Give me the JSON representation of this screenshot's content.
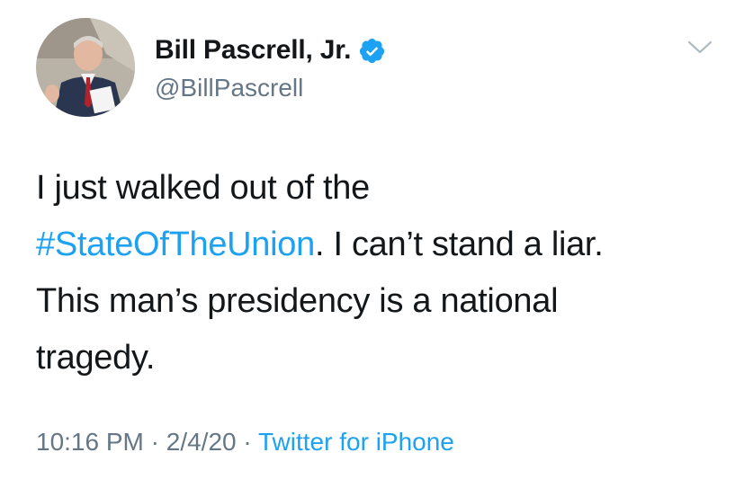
{
  "author": {
    "display_name": "Bill Pascrell, Jr.",
    "handle": "@BillPascrell",
    "verified": true
  },
  "tweet": {
    "line1": "I just walked out of the",
    "hashtag": "#StateOfTheUnion",
    "line2_rest": ". I can’t stand a liar.",
    "line3": "This man’s presidency is a national",
    "line4": "tragedy."
  },
  "meta": {
    "time": "10:16 PM",
    "separator": " · ",
    "date": "2/4/20",
    "source": "Twitter for iPhone"
  },
  "icons": {
    "verified": "verified-badge-icon",
    "menu": "chevron-down-icon"
  },
  "colors": {
    "link": "#1da1f2",
    "text": "#14171a",
    "secondary": "#657786"
  }
}
